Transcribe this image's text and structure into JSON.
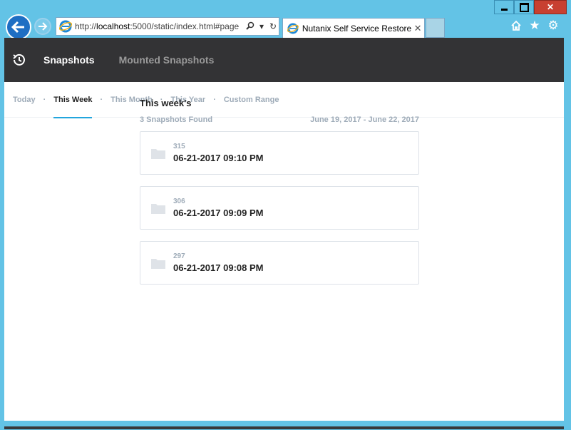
{
  "browser": {
    "address": {
      "prefix": "http://",
      "host": "localhost",
      "rest": ":5000/static/index.html#page"
    },
    "tab_title": "Nutanix Self Service Restore"
  },
  "app": {
    "nav": {
      "snapshots": "Snapshots",
      "mounted": "Mounted Snapshots"
    },
    "filters": [
      "Today",
      "This Week",
      "This Month",
      "This Year",
      "Custom Range"
    ],
    "active_filter": "This Week",
    "heading": "This week's",
    "found": "3 Snapshots Found",
    "range": "June 19, 2017 - June 22, 2017",
    "snapshots": [
      {
        "id": "315",
        "datetime": "06-21-2017 09:10 PM"
      },
      {
        "id": "306",
        "datetime": "06-21-2017 09:09 PM"
      },
      {
        "id": "297",
        "datetime": "06-21-2017 09:08 PM"
      }
    ]
  },
  "colors": {
    "appbar": "#333335",
    "accent": "#22a5dd",
    "muted": "#9eabb8"
  },
  "icons": [
    "back-icon",
    "forward-icon",
    "ie-icon",
    "search-icon",
    "dropdown-icon",
    "refresh-icon",
    "close-icon",
    "home-icon",
    "star-icon",
    "gear-icon",
    "history-icon",
    "folder-icon"
  ]
}
